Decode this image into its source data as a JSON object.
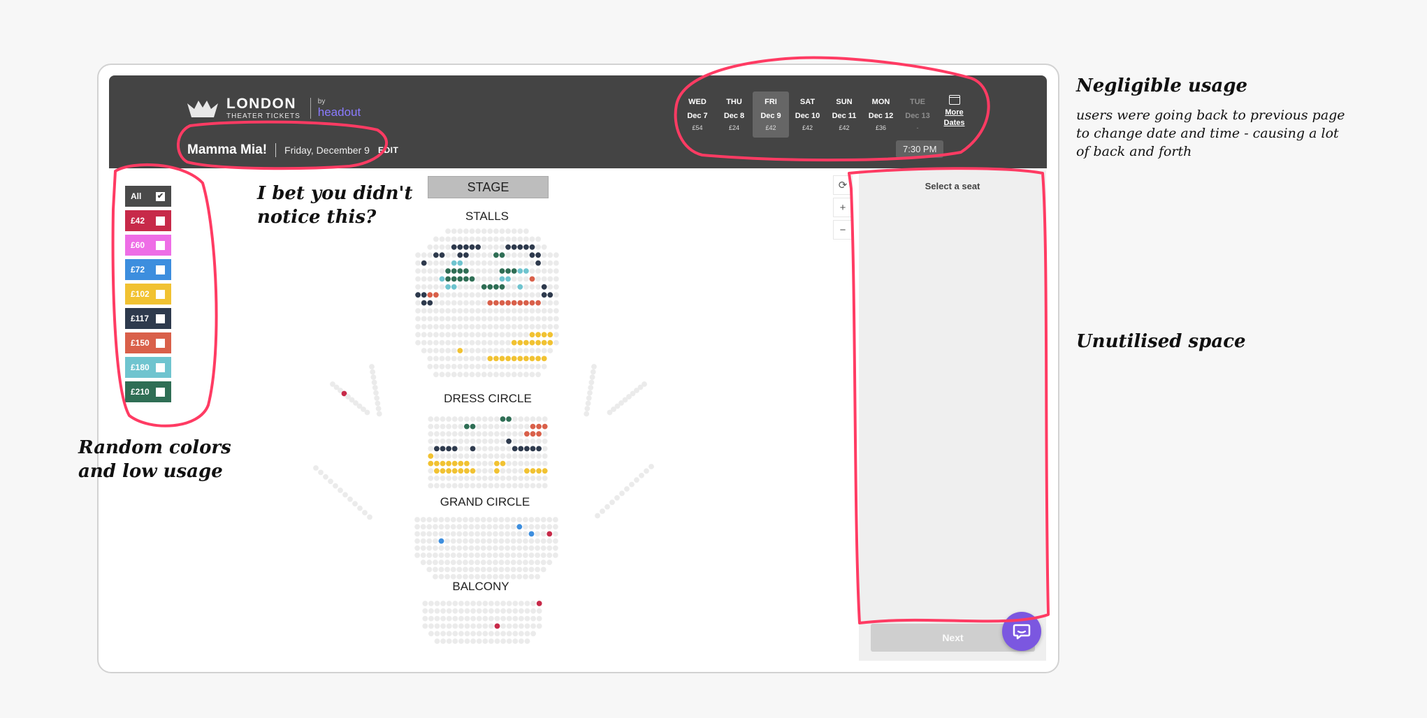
{
  "header": {
    "logo_line1": "LONDON",
    "logo_line2": "THEATER TICKETS",
    "logo_by": "by",
    "logo_brand": "headout",
    "show_name": "Mamma Mia!",
    "show_date": "Friday, December 9",
    "edit_label": "EDIT",
    "time": "7:30 PM",
    "dates": [
      {
        "dow": "WED",
        "date": "Dec 7",
        "price": "£54",
        "selected": false,
        "available": true
      },
      {
        "dow": "THU",
        "date": "Dec 8",
        "price": "£24",
        "selected": false,
        "available": true
      },
      {
        "dow": "FRI",
        "date": "Dec 9",
        "price": "£42",
        "selected": true,
        "available": true
      },
      {
        "dow": "SAT",
        "date": "Dec 10",
        "price": "£42",
        "selected": false,
        "available": true
      },
      {
        "dow": "SUN",
        "date": "Dec 11",
        "price": "£42",
        "selected": false,
        "available": true
      },
      {
        "dow": "MON",
        "date": "Dec 12",
        "price": "£36",
        "selected": false,
        "available": true
      },
      {
        "dow": "TUE",
        "date": "Dec 13",
        "price": "-",
        "selected": false,
        "available": false
      }
    ],
    "more_dates": "More Dates"
  },
  "filters": [
    {
      "label": "All",
      "color": "#4a4a4a",
      "checked": true
    },
    {
      "label": "£42",
      "color": "#c72a49",
      "checked": false
    },
    {
      "label": "£60",
      "color": "#ee6de6",
      "checked": false
    },
    {
      "label": "£72",
      "color": "#3d8ede",
      "checked": false
    },
    {
      "label": "£102",
      "color": "#f1c232",
      "checked": false
    },
    {
      "label": "£117",
      "color": "#2e3a4d",
      "checked": false
    },
    {
      "label": "£150",
      "color": "#d9604a",
      "checked": false
    },
    {
      "label": "£180",
      "color": "#6fc4cf",
      "checked": false
    },
    {
      "label": "£210",
      "color": "#2f6e55",
      "checked": false
    }
  ],
  "seatmap": {
    "stage": "STAGE",
    "sections": [
      "STALLS",
      "DRESS CIRCLE",
      "GRAND CIRCLE",
      "BALCONY"
    ]
  },
  "zoom": {
    "reset": "⟳",
    "in": "+",
    "out": "−"
  },
  "panel": {
    "title": "Select a seat",
    "next": "Next"
  },
  "annotations": {
    "negligible_title": "Negligible usage",
    "negligible_body_1": "users were going back to previous page",
    "negligible_body_2": "to change date and time - causing a lot",
    "negligible_body_3": "of back and forth",
    "unutilised": "Unutilised space",
    "bet_1": "I bet you didn't",
    "bet_2": "notice this?",
    "random_1": "Random colors",
    "random_2": "and low usage"
  },
  "colors": {
    "red": "#c72a49",
    "pink": "#ee6de6",
    "blue": "#3d8ede",
    "yellow": "#f1c232",
    "navy": "#2e3a4d",
    "orange": "#d9604a",
    "teal": "#6fc4cf",
    "green": "#2f6e55",
    "empty": "#ebebeb",
    "highlight": "#ff3b63"
  }
}
